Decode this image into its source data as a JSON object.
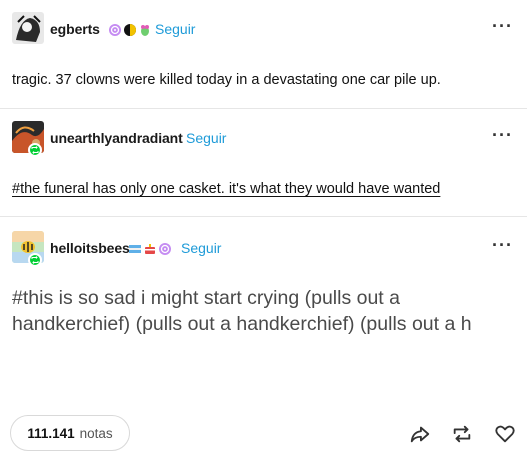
{
  "posts": [
    {
      "username": "egberts",
      "follow_label": "Seguir",
      "more_label": "···",
      "text": "tragic. 37 clowns were killed today in a devastating one car pile up."
    },
    {
      "username": "unearthlyandradiant",
      "follow_label": "Seguir",
      "more_label": "···",
      "tag": "#the funeral has only one casket. it's what they would have wanted"
    },
    {
      "username": "helloitsbees",
      "follow_label": "Seguir",
      "more_label": "···",
      "tag": "#this is so sad i might start crying (pulls out a handkerchief) (pulls out a handkerchief) (pulls out a h"
    }
  ],
  "footer": {
    "notes_count": "111.141",
    "notes_label": "notas",
    "icons": [
      "share-icon",
      "reblog-icon",
      "like-icon"
    ]
  },
  "colors": {
    "follow": "#1e9bd8",
    "reblog_badge": "#01cf35"
  }
}
